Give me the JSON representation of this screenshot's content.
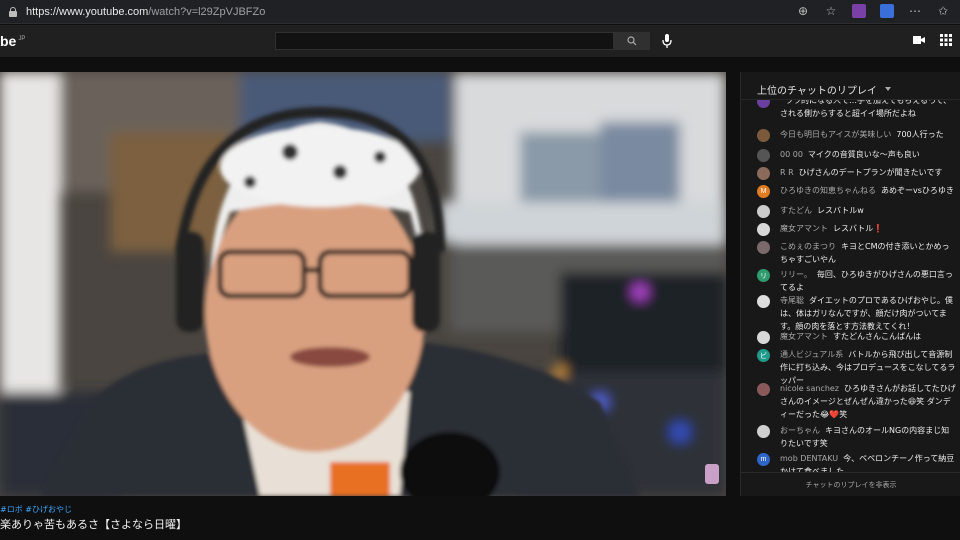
{
  "browser": {
    "url_main": "https://www.youtube.com",
    "url_rest": "/watch?v=l29ZpVJBFZo"
  },
  "header": {
    "logo": "be",
    "logo_region": "JP"
  },
  "chat": {
    "title": "上位のチャットのリプレイ",
    "replay_button": "チャットのリプレイを非表示",
    "messages": [
      {
        "author": "",
        "text": "ララ的になる人で…手を加えてもらえるって、される側からすると超イイ場所だよね",
        "avatar_color": "#6a3fa0",
        "avatar_letter": ""
      },
      {
        "author": "今日も明日もアイスが美味しい",
        "text": "700人行った",
        "avatar_color": "#7a5a3a",
        "avatar_letter": ""
      },
      {
        "author": "00 00",
        "text": "マイクの音質良いな〜声も良い",
        "avatar_color": "#555555",
        "avatar_letter": ""
      },
      {
        "author": "R R",
        "text": "ひげさんのデートプランが聞きたいです",
        "avatar_color": "#8a6a5a",
        "avatar_letter": ""
      },
      {
        "author": "ひろゆきの知恵ちゃんねる",
        "text": "あめぞーvsひろゆき",
        "avatar_color": "#e07b20",
        "avatar_letter": "M"
      },
      {
        "author": "すたどん",
        "text": "レスバトルw",
        "avatar_color": "#cccccc",
        "avatar_letter": ""
      },
      {
        "author": "魔女アマント",
        "text": "レスバトル❗",
        "avatar_color": "#d8d8d8",
        "avatar_letter": ""
      },
      {
        "author": "こめぇのまつり",
        "text": "キヨとCMの付き添いとかめっちゃすごいやん",
        "avatar_color": "#7a6a6a",
        "avatar_letter": ""
      },
      {
        "author": "リリー。",
        "text": "毎回、ひろゆきがひげさんの悪口言ってるよ",
        "avatar_color": "#2e9a6e",
        "avatar_letter": "リ"
      },
      {
        "author": "寺尾聡",
        "text": "ダイエットのプロであるひげおやじ。僕は、体はガリなんですが、顔だけ肉がついてます。顔の肉を落とす方法教えてくれ！",
        "avatar_color": "#dddddd",
        "avatar_letter": ""
      },
      {
        "author": "魔女アマント",
        "text": "すたどんさんこんばんは",
        "avatar_color": "#d8d8d8",
        "avatar_letter": ""
      },
      {
        "author": "通人ビジュアル系",
        "text": "バトルから飛び出して音源制作に打ち込み、今はプロデュースをこなしてるラッパー",
        "avatar_color": "#1f9a8a",
        "avatar_letter": "ビ"
      },
      {
        "author": "nicole sanchez",
        "text": "ひろゆきさんがお話してたひげさんのイメージとぜんぜん違かった😆笑 ダンディーだった😂❤️笑",
        "avatar_color": "#8a5a5a",
        "avatar_letter": ""
      },
      {
        "author": "おーちゃん",
        "text": "キヨさんのオールNGの内容まじ知りたいです笑",
        "avatar_color": "#cfcfcf",
        "avatar_letter": ""
      },
      {
        "author": "mob DENTAKU",
        "text": "今、ペペロンチーノ作って納豆かけて食べました。",
        "avatar_color": "#2e66c8",
        "avatar_letter": "m"
      }
    ]
  },
  "below": {
    "hashtags": "#ロボ #ひげおやじ",
    "title": "楽ありゃ苦もあるさ【さよなら日曜】"
  },
  "colors": {
    "bg": "#0f0f0f",
    "accent_link": "#3ea6ff"
  }
}
